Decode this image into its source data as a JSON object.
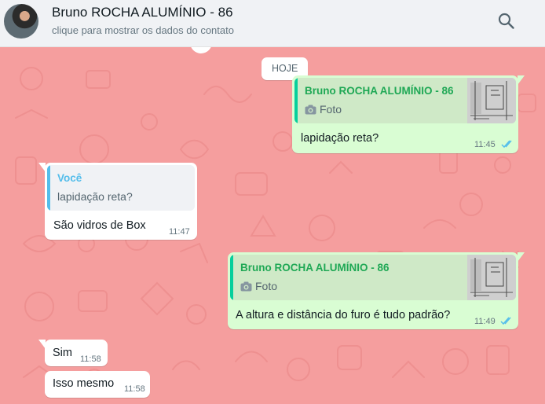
{
  "header": {
    "contact_name": "Bruno ROCHA ALUMÍNIO - 86",
    "subtitle": "clique para mostrar os dados do contato",
    "search_icon": "search-icon"
  },
  "chat": {
    "day_divider": "HOJE",
    "messages": [
      {
        "direction": "outgoing",
        "quote_author": "Bruno ROCHA ALUMÍNIO - 86",
        "quote_text": "Foto",
        "quote_icon": "camera-icon",
        "text": "lapidação reta?",
        "time": "11:45",
        "status": "read"
      },
      {
        "direction": "incoming",
        "quote_author": "Você",
        "quote_text": "lapidação reta?",
        "text": "São vidros de Box",
        "time": "11:47"
      },
      {
        "direction": "outgoing",
        "quote_author": "Bruno ROCHA ALUMÍNIO - 86",
        "quote_text": "Foto",
        "quote_icon": "camera-icon",
        "text": "A altura e distância do furo é tudo padrão?",
        "time": "11:49",
        "status": "read"
      },
      {
        "direction": "incoming",
        "text": "Sim",
        "time": "11:58"
      },
      {
        "direction": "incoming",
        "text": "Isso mesmo",
        "time": "11:58"
      }
    ]
  },
  "colors": {
    "chat_background": "#f59e9e",
    "outgoing_bubble": "#d9fdd3",
    "incoming_bubble": "#ffffff",
    "quote_bar_outgoing": "#06cf9c",
    "quote_author_outgoing": "#1fa855",
    "quote_bar_incoming": "#53bdeb",
    "quote_author_incoming": "#53bdeb",
    "read_ticks": "#53bdeb"
  }
}
